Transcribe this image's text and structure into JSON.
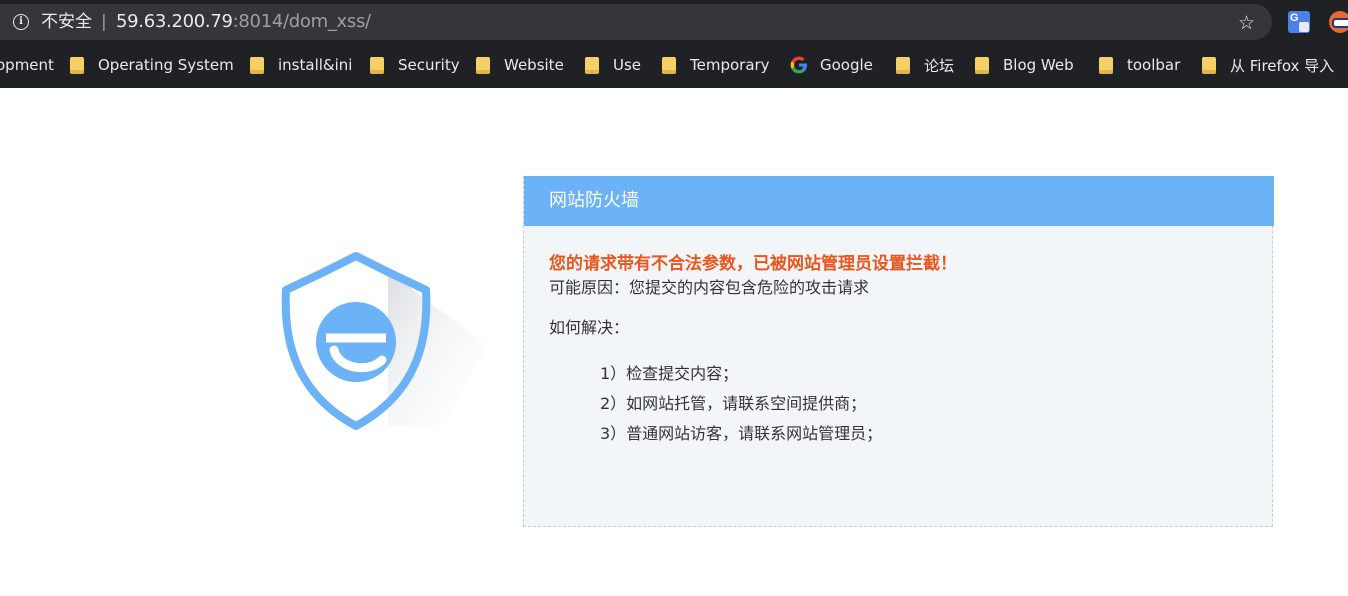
{
  "browser": {
    "security_label": "不安全",
    "separator": "|",
    "url_host": "59.63.200.79",
    "url_rest": ":8014/dom_xss/",
    "bookmarks": [
      {
        "label": "opment",
        "icon": "folder-icon"
      },
      {
        "label": "Operating System",
        "icon": "folder-icon"
      },
      {
        "label": "install&ini",
        "icon": "folder-icon"
      },
      {
        "label": "Security",
        "icon": "folder-icon"
      },
      {
        "label": "Website",
        "icon": "folder-icon"
      },
      {
        "label": "Use",
        "icon": "folder-icon"
      },
      {
        "label": "Temporary",
        "icon": "folder-icon"
      },
      {
        "label": "Google",
        "icon": "google-icon"
      },
      {
        "label": "论坛",
        "icon": "folder-icon"
      },
      {
        "label": "Blog Web",
        "icon": "folder-icon"
      },
      {
        "label": "toolbar",
        "icon": "folder-icon"
      },
      {
        "label": "从 Firefox 导入",
        "icon": "folder-icon"
      }
    ]
  },
  "firewall": {
    "title": "网站防火墙",
    "warning": "您的请求带有不合法参数，已被网站管理员设置拦截！",
    "reason": "可能原因：您提交的内容包含危险的攻击请求",
    "how_label": "如何解决：",
    "steps": [
      "1）检查提交内容；",
      "2）如网站托管，请联系空间提供商；",
      "3）普通网站访客，请联系网站管理员；"
    ]
  },
  "colors": {
    "header_blue": "#6cb2f7",
    "warning_orange": "#e8571e",
    "panel_bg": "#f3f6f9",
    "shield_blue": "#6cb2f7"
  }
}
